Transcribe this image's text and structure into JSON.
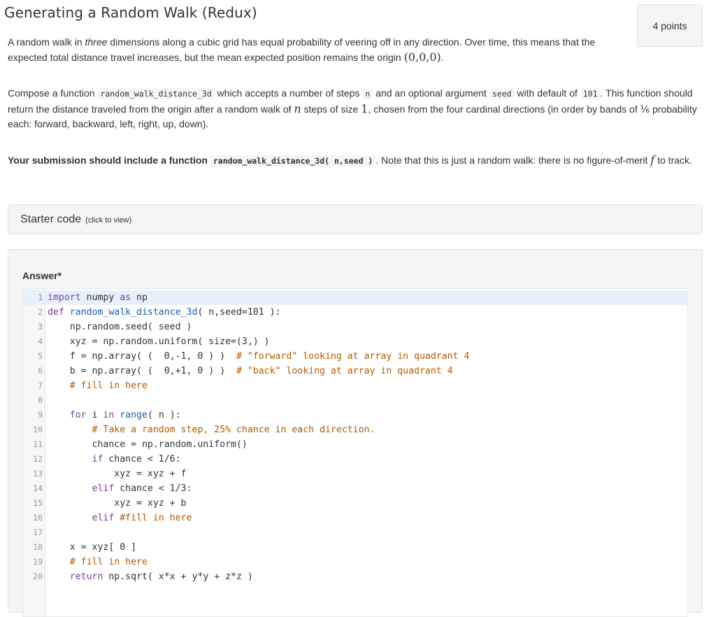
{
  "question": {
    "title": "Generating a Random Walk (Redux)",
    "points": "4 points"
  },
  "description": {
    "p1_a": "A random walk in ",
    "p1_em": "three",
    "p1_b": " dimensions along a cubic grid has equal probability of veering off in any direction. Over time, this means that the expected total distance travel increases, but the mean expected position remains the origin ",
    "p1_math": "(0,0,0)",
    "p1_c": ".",
    "p2_a": "Compose a function ",
    "p2_code1": "random_walk_distance_3d",
    "p2_b": " which accepts a number of steps ",
    "p2_code2": "n",
    "p2_c": " and an optional argument ",
    "p2_code3": "seed",
    "p2_d": " with default of ",
    "p2_code4": "101",
    "p2_e": ". This function should return the distance traveled from the origin after a random walk of ",
    "p2_var": "n",
    "p2_f": " steps of size ",
    "p2_one": "1",
    "p2_g": ", chosen from the four cardinal directions (in order by bands of ⅙ probability each: forward, backward, left, right, up, down).",
    "p3_bold": "Your submission should include a function ",
    "p3_code": "random_walk_distance_3d( n,seed )",
    "p3_a": ". Note that this is just a random walk: there is no figure-of-merit ",
    "p3_var": "f",
    "p3_b": " to track."
  },
  "starter": {
    "title": "Starter code",
    "hint": "(click to view)"
  },
  "answer": {
    "label": "Answer*",
    "line_numbers": [
      "1",
      "2",
      "3",
      "4",
      "5",
      "6",
      "7",
      "8",
      "9",
      "10",
      "11",
      "12",
      "13",
      "14",
      "15",
      "16",
      "17",
      "18",
      "19",
      "20"
    ]
  },
  "code_tokens": {
    "l1_import": "import",
    "l1_rest": " numpy ",
    "l1_as": "as",
    "l1_np": " np",
    "l2_def": "def",
    "l2_name": " random_walk_distance_3d",
    "l2_rest": "( n,seed=101 ):",
    "l3": "    np.random.seed( seed )",
    "l4": "    xyz = np.random.uniform( size=(3,) )",
    "l5_code": "    f = np.array( (  0,-1, 0 ) )  ",
    "l5_cm": "# \"forward\" looking at array in quadrant 4",
    "l6_code": "    b = np.array( (  0,+1, 0 ) )  ",
    "l6_cm": "# \"back\" looking at array in quadrant 4",
    "l7_cm": "    # fill in here",
    "l9_for": "    for",
    "l9_i": " i ",
    "l9_in": "in",
    "l9_range": " range",
    "l9_rest": "( n ):",
    "l10_cm": "        # Take a random step, 25% chance in each direction.",
    "l11": "        chance = np.random.uniform()",
    "l12_if": "        if",
    "l12_rest": " chance < 1/6:",
    "l13": "            xyz = xyz + f",
    "l14_elif": "        elif",
    "l14_rest": " chance < 1/3:",
    "l15": "            xyz = xyz + b",
    "l16_elif": "        elif",
    "l16_cm": " #fill in here",
    "l18": "    x = xyz[ 0 ]",
    "l19_cm": "    # fill in here",
    "l20_return": "    return",
    "l20_rest": " np.sqrt( x*x + y*y + z*z )"
  },
  "colors": {
    "keyword": "#7a3e9d",
    "builtin": "#1a5fa8",
    "comment": "#b35a00",
    "active_line": "#e8f0fb"
  }
}
